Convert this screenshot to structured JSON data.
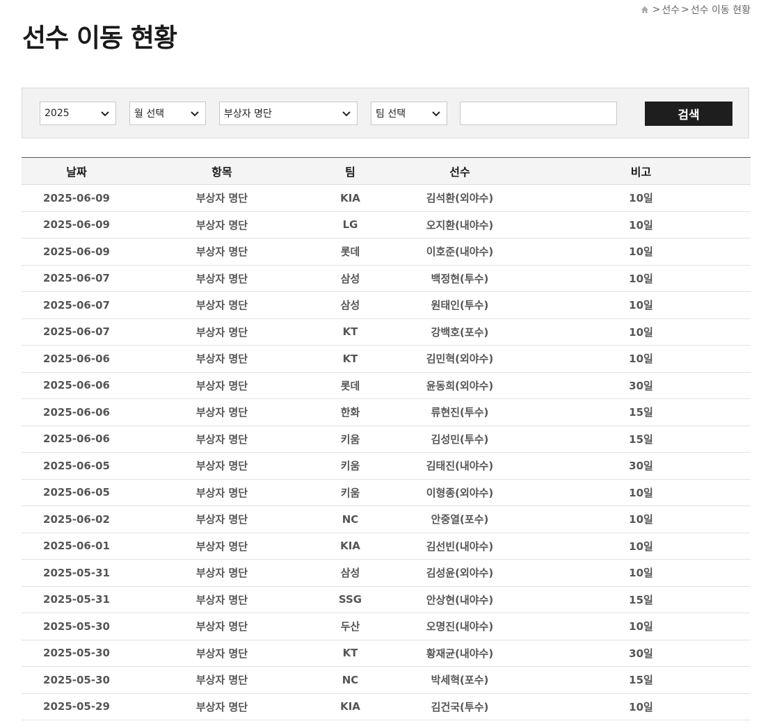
{
  "breadcrumb": {
    "sep1": ">",
    "crumb1": "선수",
    "sep2": ">",
    "crumb2": "선수 이동 현황"
  },
  "page_title": "선수 이동 현황",
  "filters": {
    "year": "2025",
    "month": "월 선택",
    "category": "부상자 명단",
    "team": "팀 선택",
    "keyword_value": "",
    "search_label": "검색"
  },
  "table": {
    "headers": {
      "date": "날짜",
      "item": "항목",
      "team": "팀",
      "player": "선수",
      "note": "비고"
    },
    "rows": [
      {
        "date": "2025-06-09",
        "item": "부상자 명단",
        "team": "KIA",
        "player": "김석환(외야수)",
        "note": "10일"
      },
      {
        "date": "2025-06-09",
        "item": "부상자 명단",
        "team": "LG",
        "player": "오지환(내야수)",
        "note": "10일"
      },
      {
        "date": "2025-06-09",
        "item": "부상자 명단",
        "team": "롯데",
        "player": "이호준(내야수)",
        "note": "10일"
      },
      {
        "date": "2025-06-07",
        "item": "부상자 명단",
        "team": "삼성",
        "player": "백정현(투수)",
        "note": "10일"
      },
      {
        "date": "2025-06-07",
        "item": "부상자 명단",
        "team": "삼성",
        "player": "원태인(투수)",
        "note": "10일"
      },
      {
        "date": "2025-06-07",
        "item": "부상자 명단",
        "team": "KT",
        "player": "강백호(포수)",
        "note": "10일"
      },
      {
        "date": "2025-06-06",
        "item": "부상자 명단",
        "team": "KT",
        "player": "김민혁(외야수)",
        "note": "10일"
      },
      {
        "date": "2025-06-06",
        "item": "부상자 명단",
        "team": "롯데",
        "player": "윤동희(외야수)",
        "note": "30일"
      },
      {
        "date": "2025-06-06",
        "item": "부상자 명단",
        "team": "한화",
        "player": "류현진(투수)",
        "note": "15일"
      },
      {
        "date": "2025-06-06",
        "item": "부상자 명단",
        "team": "키움",
        "player": "김성민(투수)",
        "note": "15일"
      },
      {
        "date": "2025-06-05",
        "item": "부상자 명단",
        "team": "키움",
        "player": "김태진(내야수)",
        "note": "30일"
      },
      {
        "date": "2025-06-05",
        "item": "부상자 명단",
        "team": "키움",
        "player": "이형종(외야수)",
        "note": "10일"
      },
      {
        "date": "2025-06-02",
        "item": "부상자 명단",
        "team": "NC",
        "player": "안중열(포수)",
        "note": "10일"
      },
      {
        "date": "2025-06-01",
        "item": "부상자 명단",
        "team": "KIA",
        "player": "김선빈(내야수)",
        "note": "10일"
      },
      {
        "date": "2025-05-31",
        "item": "부상자 명단",
        "team": "삼성",
        "player": "김성윤(외야수)",
        "note": "10일"
      },
      {
        "date": "2025-05-31",
        "item": "부상자 명단",
        "team": "SSG",
        "player": "안상현(내야수)",
        "note": "15일"
      },
      {
        "date": "2025-05-30",
        "item": "부상자 명단",
        "team": "두산",
        "player": "오명진(내야수)",
        "note": "10일"
      },
      {
        "date": "2025-05-30",
        "item": "부상자 명단",
        "team": "KT",
        "player": "황재균(내야수)",
        "note": "30일"
      },
      {
        "date": "2025-05-30",
        "item": "부상자 명단",
        "team": "NC",
        "player": "박세혁(포수)",
        "note": "15일"
      },
      {
        "date": "2025-05-29",
        "item": "부상자 명단",
        "team": "KIA",
        "player": "김건국(투수)",
        "note": "10일"
      }
    ]
  },
  "icons": {
    "home": "home-icon",
    "chevron": "chevron-down-icon"
  }
}
